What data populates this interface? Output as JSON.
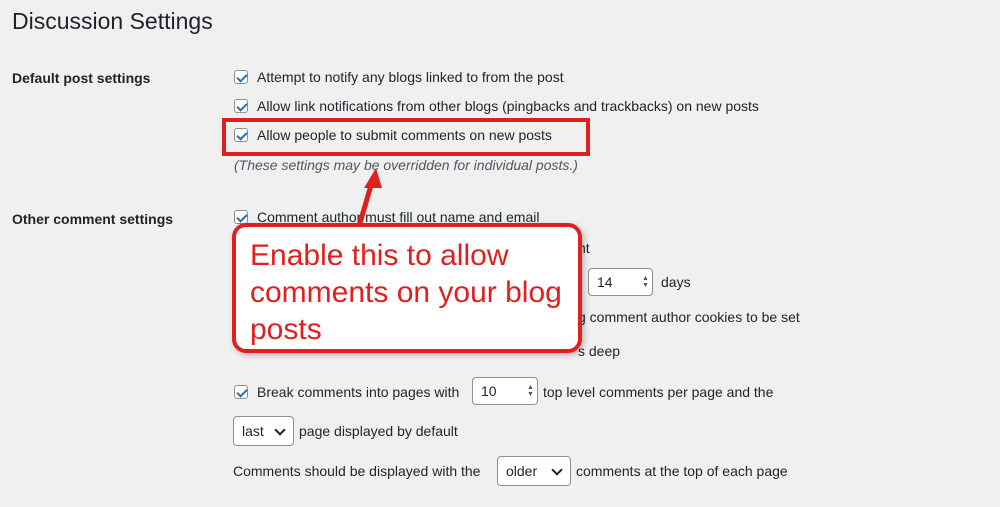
{
  "page": {
    "title": "Discussion Settings"
  },
  "default_post": {
    "label": "Default post settings",
    "opt1": "Attempt to notify any blogs linked to from the post",
    "opt2": "Allow link notifications from other blogs (pingbacks and trackbacks) on new posts",
    "opt3": "Allow people to submit comments on new posts",
    "note": "(These settings may be overridden for individual posts.)"
  },
  "other_comment": {
    "label": "Other comment settings",
    "opt1": "Comment author must fill out name and email",
    "opt2_tail": "nt",
    "days_value": "14",
    "days_label": "days",
    "cookies_tail": "g comment author cookies to be set",
    "deep_tail": "s deep",
    "break_label": "Break comments into pages with",
    "per_page_value": "10",
    "per_page_label": "top level comments per page and the",
    "page_select": "last",
    "page_default_label": "page displayed by default",
    "display_label": "Comments should be displayed with the",
    "order_select": "older",
    "order_tail": "comments at the top of each page"
  },
  "annotation": {
    "callout": "Enable this to allow comments on your blog posts",
    "color": "#e02020"
  }
}
